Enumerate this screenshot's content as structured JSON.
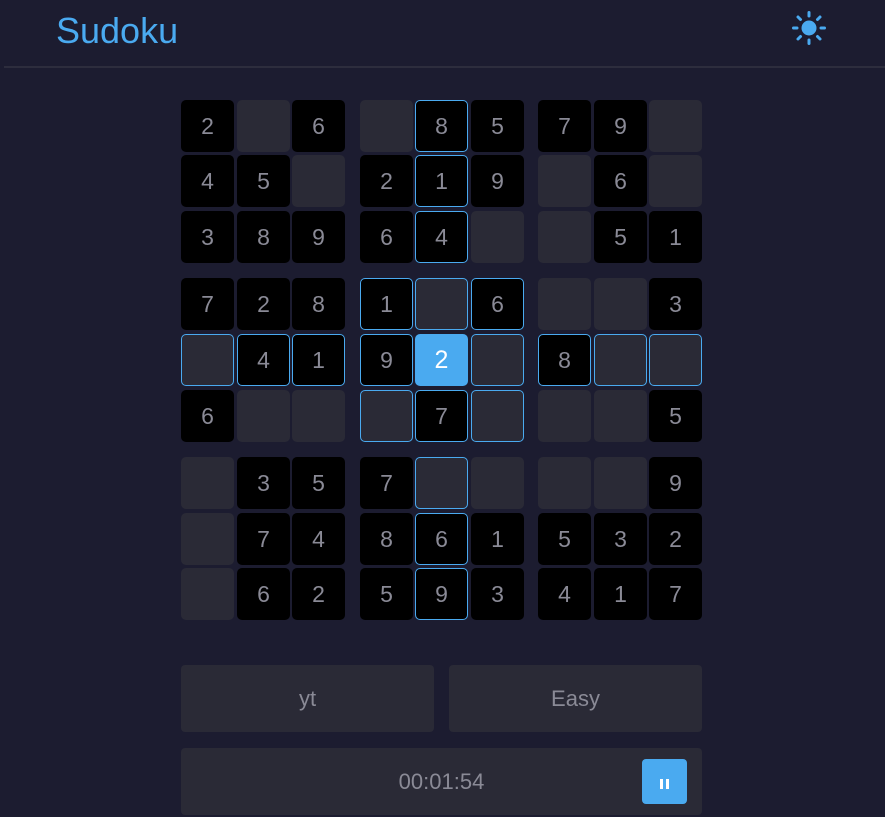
{
  "header": {
    "title": "Sudoku",
    "theme_icon": "sun-icon",
    "accent": "#4aaaf0"
  },
  "board": {
    "cells": [
      [
        2,
        0,
        6,
        0,
        8,
        5,
        7,
        9,
        0
      ],
      [
        4,
        5,
        0,
        2,
        1,
        9,
        0,
        6,
        0
      ],
      [
        3,
        8,
        9,
        6,
        4,
        0,
        0,
        5,
        1
      ],
      [
        7,
        2,
        8,
        1,
        0,
        6,
        0,
        0,
        3
      ],
      [
        0,
        4,
        1,
        9,
        2,
        0,
        8,
        0,
        0
      ],
      [
        6,
        0,
        0,
        0,
        7,
        0,
        0,
        0,
        5
      ],
      [
        0,
        3,
        5,
        7,
        0,
        0,
        0,
        0,
        9
      ],
      [
        0,
        7,
        4,
        8,
        6,
        1,
        5,
        3,
        2
      ],
      [
        0,
        6,
        2,
        5,
        9,
        3,
        4,
        1,
        7
      ]
    ],
    "selected": {
      "row": 4,
      "col": 4
    }
  },
  "info": {
    "name": "yt",
    "difficulty": "Easy"
  },
  "timer": {
    "time": "00:01:54",
    "pause_icon": "pause-icon"
  }
}
